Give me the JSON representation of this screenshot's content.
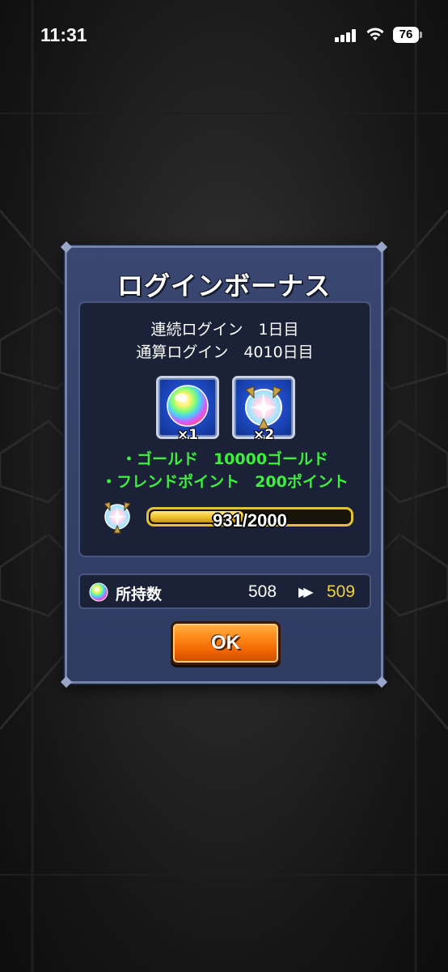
{
  "status_bar": {
    "time": "11:31",
    "battery": "76"
  },
  "dialog": {
    "title": "ログインボーナス",
    "streak_login": "連続ログイン　1日目",
    "total_login": "通算ログイン　4010日目",
    "items": [
      {
        "icon": "rainbow-orb-icon",
        "count": "×1"
      },
      {
        "icon": "friend-point-badge-icon",
        "count": "×2"
      }
    ],
    "rewards": [
      "・ゴールド　10000ゴールド",
      "・フレンドポイント　200ポイント"
    ],
    "progress": {
      "text": "931/2000",
      "value": 931,
      "max": 2000
    },
    "owned": {
      "label": "所持数",
      "before": "508",
      "after": "509"
    },
    "ok_label": "OK"
  },
  "colors": {
    "reward_text": "#3cf03c",
    "after_value": "#f3d23a",
    "ok_button": "#f06500",
    "dialog_bg": "#394771"
  }
}
